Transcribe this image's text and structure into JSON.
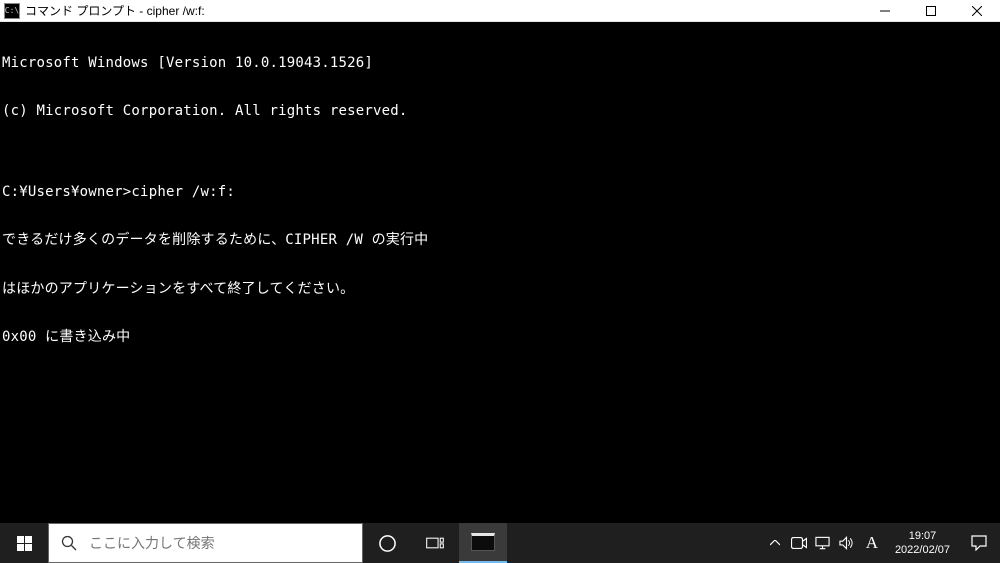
{
  "titlebar": {
    "icon_label": "C:\\",
    "title": "コマンド プロンプト - cipher  /w:f:"
  },
  "terminal": {
    "line1": "Microsoft Windows [Version 10.0.19043.1526]",
    "line2": "(c) Microsoft Corporation. All rights reserved.",
    "blank1": "",
    "prompt_line": "C:¥Users¥owner>cipher /w:f:",
    "output1": "できるだけ多くのデータを削除するために、CIPHER /W の実行中",
    "output2": "はほかのアプリケーションをすべて終了してください。",
    "output3": "0x00 に書き込み中"
  },
  "taskbar": {
    "search_placeholder": "ここに入力して検索",
    "ime_mode": "A",
    "time": "19:07",
    "date": "2022/02/07"
  }
}
